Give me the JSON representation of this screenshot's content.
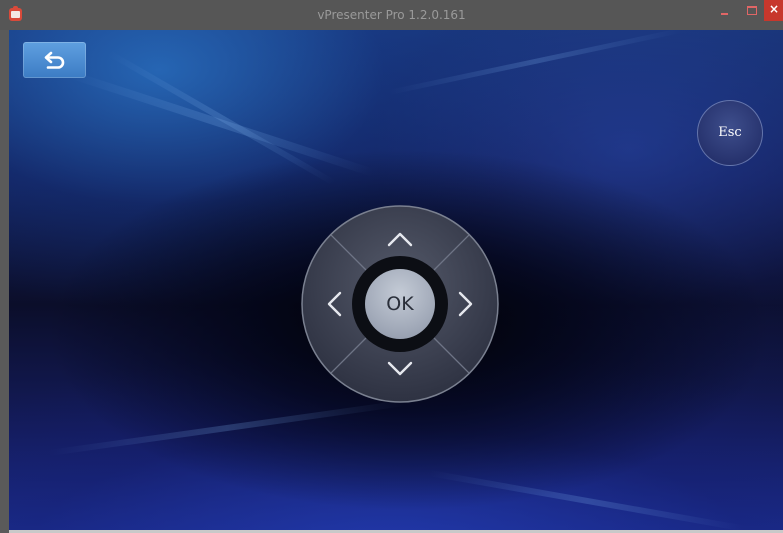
{
  "window": {
    "title": "vPresenter Pro 1.2.0.161",
    "app_icon": "projector-app-icon",
    "controls": {
      "minimize_icon": "minimize-icon",
      "maximize_icon": "maximize-icon",
      "close_label": "×"
    }
  },
  "toolbar": {
    "back_icon": "back-arrow-icon"
  },
  "remote": {
    "esc_label": "Esc",
    "ok_label": "OK",
    "up_icon": "chevron-up-icon",
    "down_icon": "chevron-down-icon",
    "left_icon": "chevron-left-icon",
    "right_icon": "chevron-right-icon"
  },
  "colors": {
    "titlebar": "#565656",
    "close_button": "#c7372c",
    "back_button": "#4a8ad0",
    "ok_button": "#a3abba"
  }
}
